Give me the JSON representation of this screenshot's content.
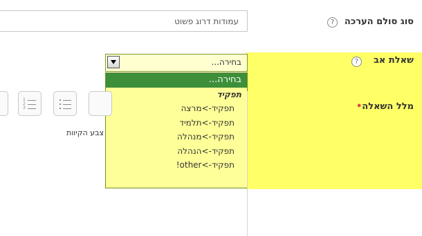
{
  "fields": {
    "scale_type": {
      "label": "סוג סולם הערכה",
      "help": "?",
      "value": "עמודות דרוג פשוט"
    },
    "parent_question": {
      "label": "שאלת אב",
      "help": "?",
      "selected": "בחירה...",
      "options": [
        {
          "label": "בחירה...",
          "kind": "selected"
        },
        {
          "label": "תפקיד",
          "kind": "group"
        },
        {
          "label": "תפקיד->מרצה",
          "kind": "child"
        },
        {
          "label": "תפקיד->תלמיד",
          "kind": "child"
        },
        {
          "label": "תפקיד->מנהלה",
          "kind": "child"
        },
        {
          "label": "תפקיד->הנהלה",
          "kind": "child"
        },
        {
          "label": "תפקיד->other!",
          "kind": "child"
        }
      ]
    },
    "question_text": {
      "label": "מלל השאלה",
      "required_mark": "•",
      "toolbar": {
        "text_color_label": "צבע הקיוות"
      }
    }
  },
  "colors": {
    "highlight": "#ffff66",
    "selected_option": "#3d8f3a",
    "required": "#e4424d"
  }
}
